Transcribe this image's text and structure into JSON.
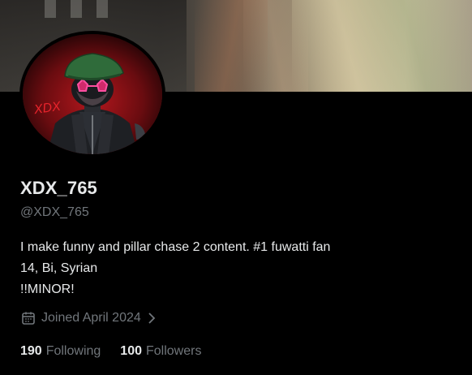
{
  "profile": {
    "display_name": "XDX_765",
    "handle": "@XDX_765",
    "bio_lines": [
      "I make funny and pillar chase 2 content. #1 fuwatti fan",
      "14, Bi, Syrian",
      "!!MINOR!"
    ],
    "joined": "Joined April 2024",
    "avatar_text": "XDX",
    "following_count": "190",
    "following_label": "Following",
    "followers_count": "100",
    "followers_label": "Followers"
  },
  "icons": {
    "calendar": "calendar-icon",
    "chevron": "chevron-right-icon"
  },
  "colors": {
    "background": "#000000",
    "primary_text": "#e7e9ea",
    "secondary_text": "#71767b",
    "avatar_accent": "#c4141c",
    "avatar_hat": "#2f6b3a",
    "avatar_glasses": "#ff3d8a"
  }
}
